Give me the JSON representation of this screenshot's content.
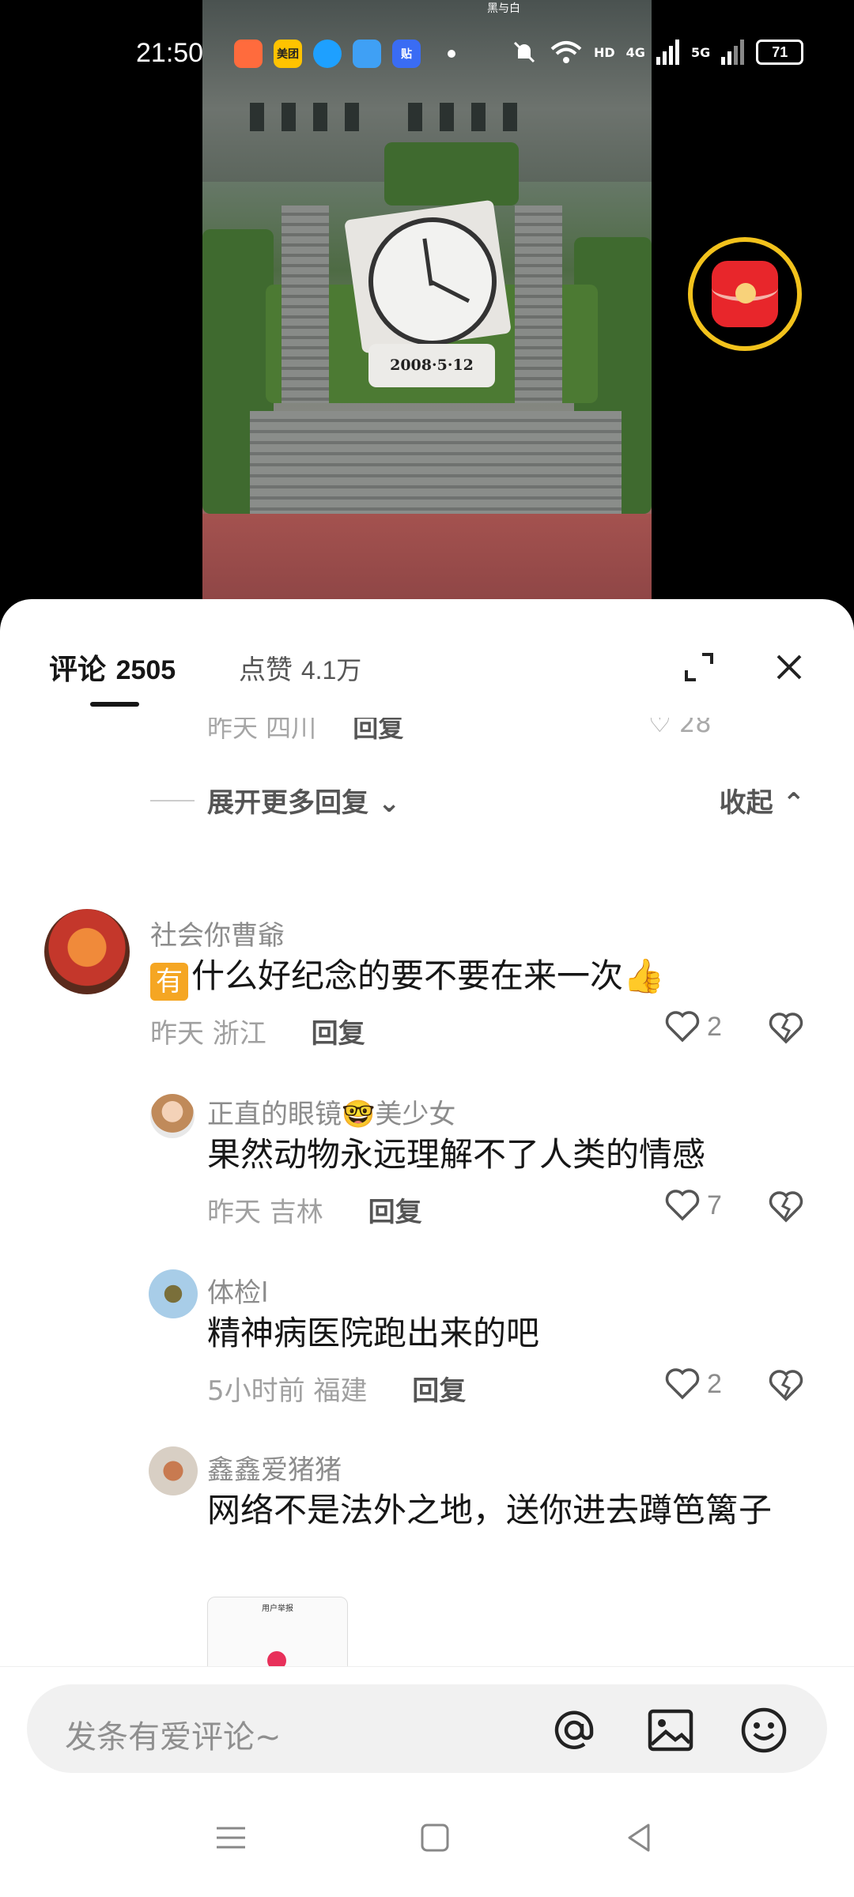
{
  "status_bar": {
    "time": "21:50",
    "app_icons": [
      {
        "name": "app-orange-icon",
        "label": "",
        "color": "#ff6b3d"
      },
      {
        "name": "meituan-icon",
        "label": "美团",
        "color": "#ffc300"
      },
      {
        "name": "qq-icon",
        "label": "",
        "color": "#1ea0ff"
      },
      {
        "name": "weather-icon",
        "label": "",
        "color": "#3fa0f5"
      },
      {
        "name": "tie-icon",
        "label": "贴",
        "color": "#3a6cf4"
      }
    ],
    "hd_label": "HD",
    "net_4g": "4G",
    "net_5g": "5G",
    "battery": "71"
  },
  "video": {
    "watermark": "黑与白",
    "date_plaque": "2008·5·12"
  },
  "sheet": {
    "tab_comments_label": "评论",
    "tab_comments_count": "2505",
    "tab_likes_label": "点赞",
    "tab_likes_count": "4.1万"
  },
  "previous": {
    "meta": "昨天 四川",
    "reply": "回复",
    "likes": "28"
  },
  "expand_more": "展开更多回复",
  "collapse": "收起",
  "comments": [
    {
      "user": "社会你曹爺",
      "badge": "有",
      "text": "什么好纪念的要不要在来一次👍",
      "meta": "昨天 浙江",
      "reply": "回复",
      "likes": "2"
    },
    {
      "user": "正直的眼镜🤓美少女",
      "text": "果然动物永远理解不了人类的情感",
      "meta": "昨天 吉林",
      "reply": "回复",
      "likes": "7"
    },
    {
      "user": "体检l",
      "text": "精神病医院跑出来的吧",
      "meta": "5小时前 福建",
      "reply": "回复",
      "likes": "2"
    },
    {
      "user": "鑫鑫爱猪猪",
      "text": "网络不是法外之地，送你进去蹲笆篱子",
      "thumb_header": "用户举报"
    }
  ],
  "input": {
    "placeholder": "发条有爱评论~"
  }
}
